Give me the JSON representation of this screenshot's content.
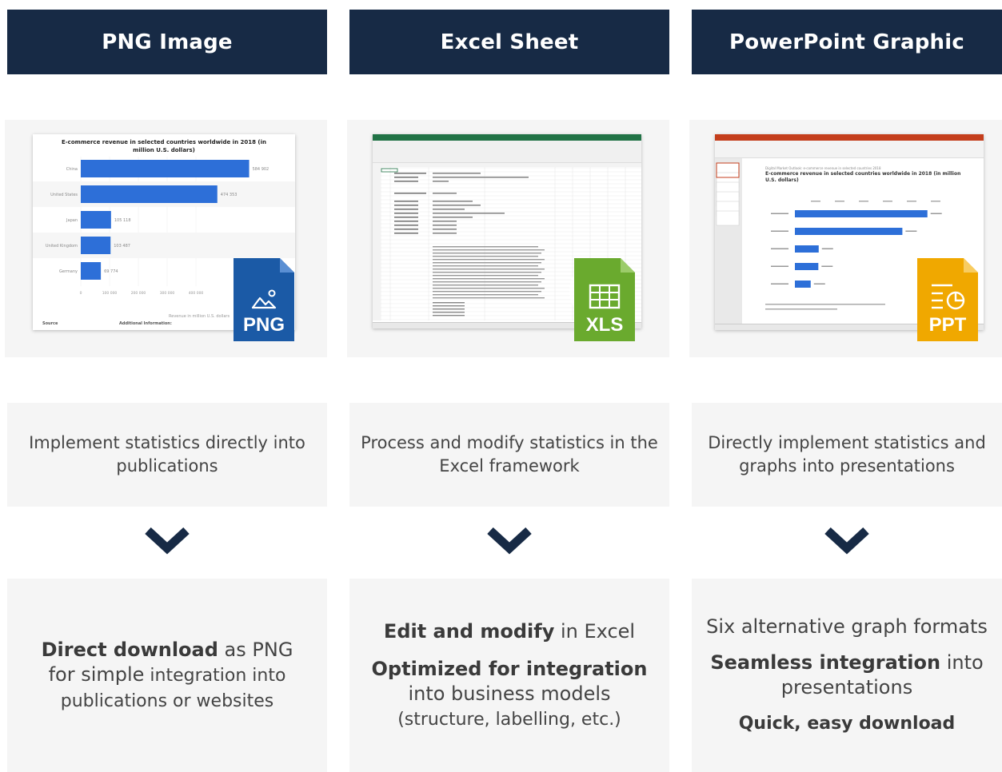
{
  "columns": [
    {
      "title": "PNG Image",
      "description": "Implement statistics directly into publications",
      "badge": "PNG",
      "badge_color": "#1b5aa6",
      "feature": {
        "bold": "Direct download",
        "text1": " as PNG",
        "text2": "for simple",
        "text3": " integration into publications or websites"
      },
      "thumbnail": {
        "title": "E-commerce revenue in selected countries worldwide in 2018 (in million U.S. dollars)",
        "categories": [
          "China",
          "United States",
          "Japan",
          "United Kingdom",
          "Germany"
        ],
        "values": [
          584.902,
          474.353,
          105.118,
          103.487,
          69.774
        ],
        "labels": [
          "584 902",
          "474 353",
          "105 118",
          "103 487",
          "69 774"
        ],
        "ticks": [
          "0",
          "100 000",
          "200 000",
          "300 000",
          "400 000"
        ],
        "axis_label": "Revenue in million U.S. dollars",
        "source_label": "Source",
        "info_label": "Additional Information:"
      }
    },
    {
      "title": "Excel Sheet",
      "description": "Process and modify statistics in the Excel framework",
      "badge": "XLS",
      "badge_color": "#6aaa2e",
      "feature": {
        "bold1": "Edit and modify",
        "text1": " in Excel",
        "bold2": "Optimized for integration",
        "text2": "into business models",
        "text3": "(structure, labelling, etc.)"
      }
    },
    {
      "title": "PowerPoint Graphic",
      "description": "Directly implement statistics and graphs into presentations",
      "badge": "PPT",
      "badge_color": "#f0a800",
      "feature": {
        "text1": "Six alternative graph formats",
        "bold1": "Seamless integration",
        "text2": " into presentations",
        "bold2": "Quick, easy download"
      },
      "thumbnail": {
        "subtitle": "Digital Market Outlook: e-commerce revenue in selected countries 2018",
        "title": "E-commerce revenue in selected countries worldwide in 2018 (in million U.S. dollars)"
      }
    }
  ],
  "colors": {
    "header_bg": "#172a45",
    "panel_bg": "#f5f5f5",
    "bar_blue": "#2d6fd8",
    "chevron": "#172a45"
  }
}
